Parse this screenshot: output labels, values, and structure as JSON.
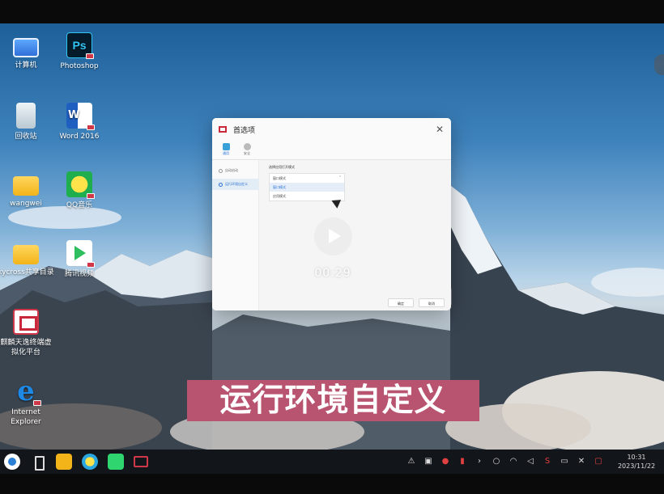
{
  "desktop_icons": [
    {
      "label": "计算机",
      "icon": "computer-icon"
    },
    {
      "label": "Photoshop",
      "icon": "photoshop-icon",
      "glyph": "Ps"
    },
    {
      "label": "回收站",
      "icon": "recycle-bin-icon"
    },
    {
      "label": "Word 2016",
      "icon": "word-icon",
      "glyph": "W"
    },
    {
      "label": "wangwei",
      "icon": "folder-icon"
    },
    {
      "label": "QQ音乐",
      "icon": "qq-music-icon"
    },
    {
      "label": "kycross共享目录",
      "icon": "folder-icon"
    },
    {
      "label": "腾讯视频",
      "icon": "tencent-video-icon"
    },
    {
      "label": "麒麟天逸终端虚拟化平台",
      "icon": "kylin-icon"
    },
    {
      "label": "Internet Explorer",
      "icon": "ie-icon",
      "glyph": "e"
    }
  ],
  "dialog": {
    "title": "首选项",
    "close_glyph": "✕",
    "toolbar": [
      {
        "label": "通用",
        "active": true
      },
      {
        "label": "安全",
        "active": false
      }
    ],
    "sidebar": [
      {
        "label": "自动启动",
        "active": false
      },
      {
        "label": "运行环境自定义",
        "active": true
      }
    ],
    "section_title": "选择应用打开模式",
    "options": [
      {
        "label": "窗口模式",
        "selected": false
      },
      {
        "label": "窗口模式",
        "selected": true
      },
      {
        "label": "应用模式",
        "selected": false
      }
    ],
    "caret_glyph": "⌃",
    "ok_label": "确定",
    "cancel_label": "取消"
  },
  "video": {
    "time": "00:29"
  },
  "caption": "运行环境自定义",
  "taskbar": {
    "tray_glyphs": [
      "⚠",
      "▣",
      "●",
      "▮",
      "›",
      "○",
      "◠",
      "◁",
      "S",
      "▭",
      "✕",
      "▢"
    ],
    "clock_time": "10:31",
    "clock_date": "2023/11/22"
  },
  "colors": {
    "caption_bg": "#b8546f",
    "accent": "#2a6fd6",
    "kylin_red": "#c8283a"
  }
}
